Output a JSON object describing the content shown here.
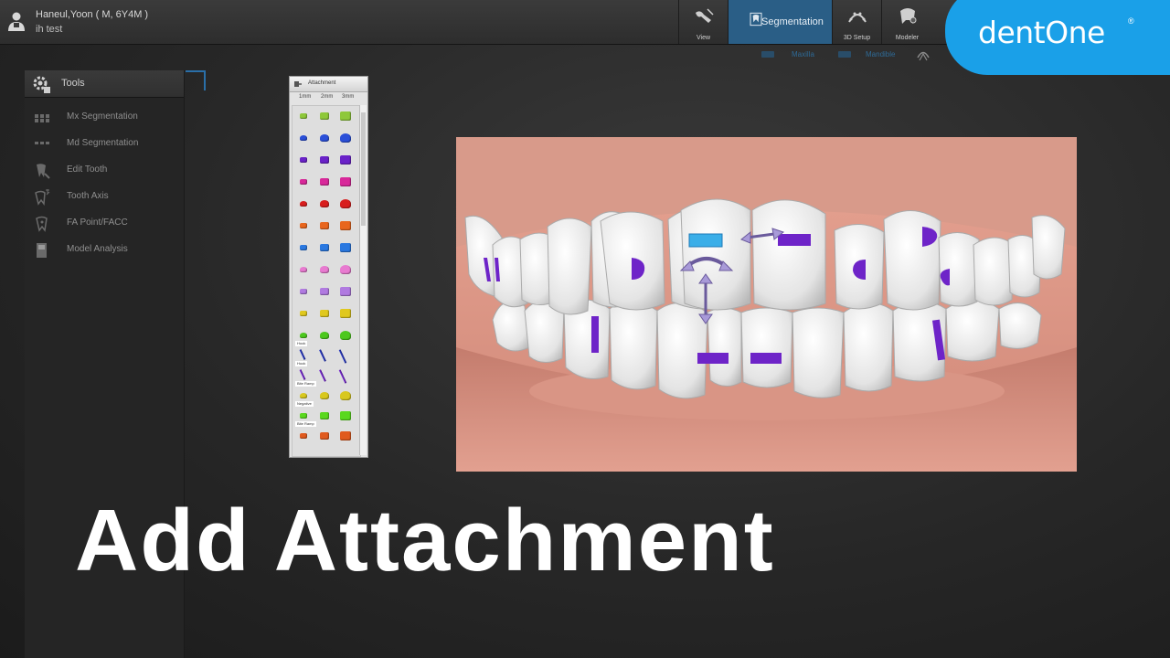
{
  "patient": {
    "name": "Haneul,Yoon ( M, 6Y4M )",
    "case": "ih test"
  },
  "modes": [
    {
      "label": "View",
      "icon": "view-icon"
    },
    {
      "label": "Segmentation",
      "icon": "segmentation-icon"
    },
    {
      "label": "3D Setup",
      "icon": "3d-setup-icon"
    },
    {
      "label": "Modeler",
      "icon": "modeler-icon"
    }
  ],
  "logo": {
    "text": "dentOne",
    "mark": "®"
  },
  "jaw": {
    "maxilla": "Maxilla",
    "mandible": "Mandible"
  },
  "tools": {
    "title": "Tools",
    "items": [
      {
        "label": "Mx Segmentation",
        "icon": "mx-segmentation-icon"
      },
      {
        "label": "Md Segmentation",
        "icon": "md-segmentation-icon"
      },
      {
        "label": "Edit Tooth",
        "icon": "edit-tooth-icon"
      },
      {
        "label": "Tooth Axis",
        "icon": "tooth-axis-icon"
      },
      {
        "label": "FA Point/FACC",
        "icon": "fa-point-icon"
      },
      {
        "label": "Model Analysis",
        "icon": "model-analysis-icon"
      }
    ]
  },
  "attachment_palette": {
    "title": "Attachment",
    "sizes": [
      "1mm",
      "2mm",
      "3mm"
    ],
    "sections": [
      "Hook",
      "Hook",
      "Bite Ramp",
      "Negative",
      "Bite Ramp"
    ],
    "colors": [
      "#8ec83a",
      "#2a4fd8",
      "#6a22c8",
      "#d8289a",
      "#d81e1e",
      "#e8661e",
      "#2a78e0",
      "#e87ad0",
      "#b07ae0",
      "#e0c81e",
      "#4cc81e",
      "#2a3ac8",
      "#7a2ad8",
      "#d8c81e",
      "#5ad81e",
      "#e05a1e"
    ]
  },
  "caption": "Add Attachment"
}
